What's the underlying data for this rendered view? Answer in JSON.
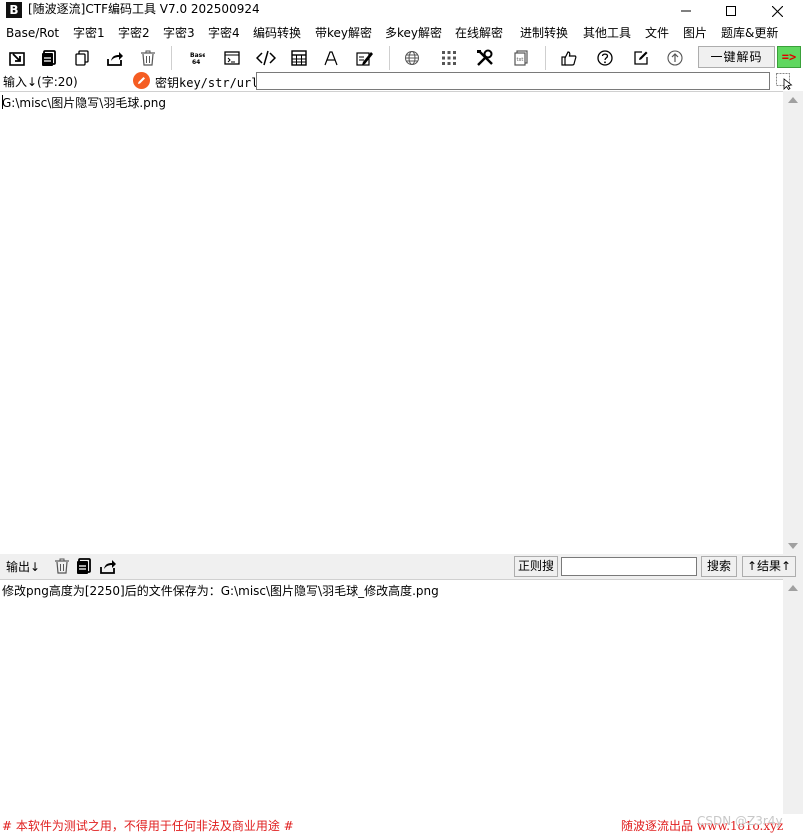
{
  "window": {
    "title": "[随波逐流]CTF编码工具 V7.0  202500924"
  },
  "menu": {
    "items": [
      "Base/Rot",
      "字密1",
      "字密2",
      "字密3",
      "字密4",
      "编码转换",
      "带key解密",
      "多key解密",
      "在线解密",
      "进制转换",
      "其他工具",
      "文件",
      "图片",
      "题库&更新"
    ]
  },
  "toolbar": {
    "icons": [
      "import-icon",
      "copy-all-icon",
      "copy-icon",
      "share-icon",
      "trash-icon",
      "base64-icon",
      "terminal-icon",
      "code-icon",
      "calculator-icon",
      "font-icon",
      "edit-doc-icon",
      "globe-icon",
      "grid-icon",
      "tools-icon",
      "document-icon",
      "thumbs-up-icon",
      "help-icon",
      "note-icon",
      "upload-icon"
    ],
    "decode_label": "一键解码",
    "arrow_label": "=>"
  },
  "input": {
    "label": "输入↓(字:20)",
    "key_label": "密钥key/str/url:",
    "key_value": "",
    "text": "G:\\misc\\图片隐写\\羽毛球.png"
  },
  "output": {
    "label": "输出↓",
    "regex_label": "正则搜",
    "regex_value": "",
    "search_label": "搜索",
    "result_label": "↑结果↑",
    "text": "修改png高度为[2250]后的文件保存为：G:\\misc\\图片隐写\\羽毛球_修改高度.png"
  },
  "footer": {
    "left": "# 本软件为测试之用，不得用于任何非法及商业用途 #",
    "right": "随波逐流出品 www.1o1o.xyz",
    "watermark": "CSDN @Z3r4y"
  },
  "colors": {
    "accent_red": "#e02020",
    "arrow_green": "#5fd75f",
    "key_orange": "#f55d22"
  }
}
